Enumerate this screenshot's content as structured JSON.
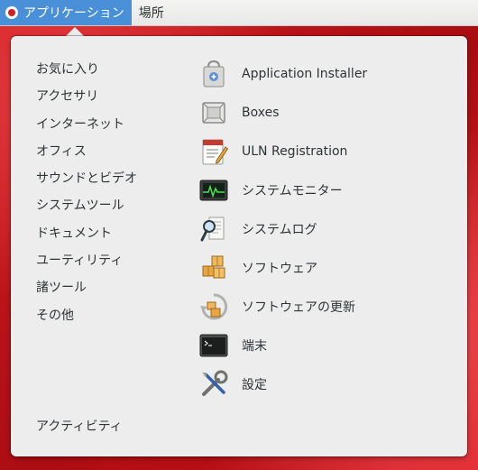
{
  "topbar": {
    "applications_label": "アプリケーション",
    "places_label": "場所"
  },
  "menu": {
    "categories": [
      "お気に入り",
      "アクセサリ",
      "インターネット",
      "オフィス",
      "サウンドとビデオ",
      "システムツール",
      "ドキュメント",
      "ユーティリティ",
      "諸ツール",
      "その他"
    ],
    "activities_label": "アクティビティ",
    "apps": [
      {
        "label": "Application Installer",
        "icon": "application-installer-icon"
      },
      {
        "label": "Boxes",
        "icon": "boxes-icon"
      },
      {
        "label": "ULN Registration",
        "icon": "uln-registration-icon"
      },
      {
        "label": "システムモニター",
        "icon": "system-monitor-icon"
      },
      {
        "label": "システムログ",
        "icon": "system-log-icon"
      },
      {
        "label": "ソフトウェア",
        "icon": "software-icon"
      },
      {
        "label": "ソフトウェアの更新",
        "icon": "software-update-icon"
      },
      {
        "label": "端末",
        "icon": "terminal-icon"
      },
      {
        "label": "設定",
        "icon": "settings-icon"
      }
    ]
  },
  "colors": {
    "highlight": "#4a90d9",
    "menu_bg": "#ededed",
    "desktop_red": "#c8141a"
  }
}
